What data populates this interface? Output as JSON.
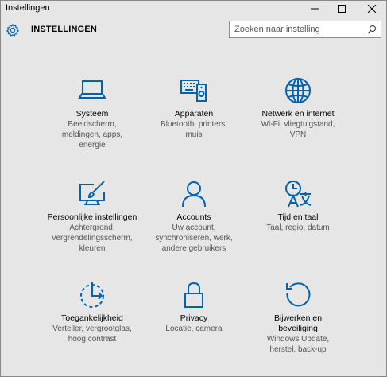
{
  "window": {
    "title": "Instellingen"
  },
  "header": {
    "heading": "INSTELLINGEN",
    "search_placeholder": "Zoeken naar instelling"
  },
  "colors": {
    "accent": "#0063b1",
    "background": "#e6e6e6"
  },
  "tiles": [
    {
      "name": "Systeem",
      "desc": [
        "Beeldscherm,",
        "meldingen, apps,",
        "energie"
      ],
      "icon": "laptop-icon"
    },
    {
      "name": "Apparaten",
      "desc": [
        "Bluetooth, printers,",
        "muis"
      ],
      "icon": "devices-icon"
    },
    {
      "name": "Netwerk en internet",
      "desc": [
        "Wi-Fi, vliegtuigstand,",
        "VPN"
      ],
      "icon": "globe-icon"
    },
    {
      "name": "Persoonlijke instellingen",
      "desc": [
        "Achtergrond,",
        "vergrendelingsscherm,",
        "kleuren"
      ],
      "icon": "personalization-icon"
    },
    {
      "name": "Accounts",
      "desc": [
        "Uw account,",
        "synchroniseren, werk,",
        "andere gebruikers"
      ],
      "icon": "person-icon"
    },
    {
      "name": "Tijd en taal",
      "desc": [
        "Taal, regio, datum"
      ],
      "icon": "time-language-icon"
    },
    {
      "name": "Toegankelijkheid",
      "desc": [
        "Verteller, vergrootglas,",
        "hoog contrast"
      ],
      "icon": "ease-of-access-icon"
    },
    {
      "name": "Privacy",
      "desc": [
        "Locatie, camera"
      ],
      "icon": "lock-icon"
    },
    {
      "name": "Bijwerken en",
      "name2": "beveiliging",
      "desc": [
        "Windows Update,",
        "herstel, back-up"
      ],
      "icon": "update-icon"
    }
  ]
}
